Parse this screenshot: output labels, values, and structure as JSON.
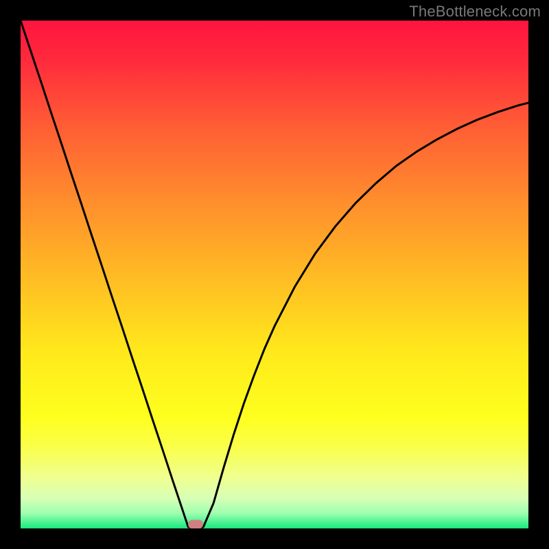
{
  "watermark": "TheBottleneck.com",
  "chart_data": {
    "type": "line",
    "title": "",
    "xlabel": "",
    "ylabel": "",
    "xlim": [
      0,
      1
    ],
    "ylim": [
      0,
      1
    ],
    "x": [
      0.0,
      0.02,
      0.04,
      0.06,
      0.08,
      0.1,
      0.12,
      0.14,
      0.16,
      0.18,
      0.2,
      0.22,
      0.24,
      0.26,
      0.28,
      0.3,
      0.32,
      0.33,
      0.34,
      0.35,
      0.36,
      0.38,
      0.4,
      0.42,
      0.44,
      0.46,
      0.48,
      0.5,
      0.54,
      0.58,
      0.62,
      0.66,
      0.7,
      0.74,
      0.78,
      0.82,
      0.86,
      0.9,
      0.94,
      0.98,
      1.0
    ],
    "values": [
      1.0,
      0.94,
      0.88,
      0.819,
      0.759,
      0.698,
      0.638,
      0.577,
      0.517,
      0.456,
      0.396,
      0.335,
      0.275,
      0.214,
      0.154,
      0.093,
      0.033,
      0.003,
      0.0,
      0.0,
      0.003,
      0.05,
      0.12,
      0.186,
      0.247,
      0.302,
      0.353,
      0.398,
      0.476,
      0.541,
      0.595,
      0.641,
      0.68,
      0.714,
      0.742,
      0.766,
      0.787,
      0.805,
      0.82,
      0.833,
      0.838
    ],
    "marker": {
      "x": 0.345,
      "y": 0.0,
      "shape": "pill",
      "color": "#d08080"
    },
    "background_gradient": "red-yellow-green",
    "grid": false,
    "legend": false
  },
  "colors": {
    "gradient_stops": [
      {
        "stop": 0.0,
        "color": "#ff143e"
      },
      {
        "stop": 0.08,
        "color": "#ff2b3c"
      },
      {
        "stop": 0.2,
        "color": "#ff5a35"
      },
      {
        "stop": 0.35,
        "color": "#ff8c2d"
      },
      {
        "stop": 0.5,
        "color": "#ffba24"
      },
      {
        "stop": 0.65,
        "color": "#ffe81c"
      },
      {
        "stop": 0.78,
        "color": "#feff1e"
      },
      {
        "stop": 0.84,
        "color": "#faff4a"
      },
      {
        "stop": 0.9,
        "color": "#efff90"
      },
      {
        "stop": 0.94,
        "color": "#d8ffb5"
      },
      {
        "stop": 0.97,
        "color": "#9effb0"
      },
      {
        "stop": 1.0,
        "color": "#18e97e"
      }
    ],
    "curve": "#000000",
    "marker": "#d08080",
    "frame": "#000000"
  }
}
